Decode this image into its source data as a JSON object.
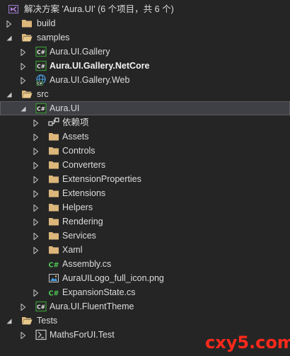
{
  "solution": {
    "title": "解决方案 'Aura.UI' (6 个项目，共 6 个)"
  },
  "colors": {
    "background": "#252526",
    "text": "#dcdcdc",
    "folder": "#dcb67a",
    "csharp_project": "#388a34",
    "csharp_file": "#4ec954",
    "arrow": "#c8c8c8",
    "selection": "#3f3f46",
    "watermark": "#ff2a1a"
  },
  "tree": {
    "build": "build",
    "samples": "samples",
    "gallery": "Aura.UI.Gallery",
    "gallery_netcore": "Aura.UI.Gallery.NetCore",
    "gallery_web": "Aura.UI.Gallery.Web",
    "src": "src",
    "aura_ui": "Aura.UI",
    "dependencies": "依赖项",
    "assets": "Assets",
    "controls": "Controls",
    "converters": "Converters",
    "extension_properties": "ExtensionProperties",
    "extensions": "Extensions",
    "helpers": "Helpers",
    "rendering": "Rendering",
    "services": "Services",
    "xaml": "Xaml",
    "assembly_cs": "Assembly.cs",
    "logo_png": "AuraUILogo_full_icon.png",
    "expansion_state_cs": "ExpansionState.cs",
    "fluent_theme": "Aura.UI.FluentTheme",
    "tests": "Tests",
    "maths_test": "MathsForUI.Test"
  },
  "watermark": "cxy5.com"
}
